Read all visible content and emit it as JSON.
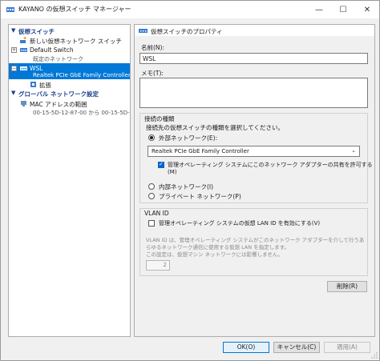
{
  "window": {
    "title": "KAYANO の仮想スイッチ マネージャー",
    "controls": {
      "minimize": "—",
      "maximize": "☐",
      "close": "✕"
    }
  },
  "left_pane": {
    "virtual_switches_header": "仮想スイッチ",
    "items": [
      {
        "label": "新しい仮想ネットワーク スイッチ"
      },
      {
        "label": "Default Switch",
        "sub": "既定のネットワーク",
        "expander": "+"
      },
      {
        "label": "WSL",
        "sub": "Realtek PCIe GbE Family Controller",
        "expander": "−",
        "selected": true
      },
      {
        "label": "拡張"
      }
    ],
    "global_header": "グローバル ネットワーク設定",
    "global_items": [
      {
        "label": "MAC アドレスの範囲",
        "sub": "00-15-5D-12-87-00 から 00-15-5D-..."
      }
    ]
  },
  "right_pane": {
    "header": "仮想スイッチのプロパティ",
    "name_label": "名前(N):",
    "name_value": "WSL",
    "memo_label": "メモ(T):",
    "memo_value": "",
    "connection": {
      "title": "接続の種類",
      "prompt": "接続先の仮想スイッチの種類を選択してください。",
      "external_label": "外部ネットワーク(E):",
      "external_selected": true,
      "adapter_value": "Realtek PCIe GbE Family Controller",
      "share_label_1": "管理オペレーティング システムにこのネットワーク アダプターの共有を許可する",
      "share_label_2": "(M)",
      "share_checked": true,
      "internal_label": "内部ネットワーク(I)",
      "private_label": "プライベート ネットワーク(P)"
    },
    "vlan": {
      "title": "VLAN ID",
      "enable_label": "管理オペレーティング システムの仮想 LAN ID を有効にする(V)",
      "enable_checked": false,
      "desc_1": "VLAN ID は、管理オペレーティング システムがこのネットワーク アダプターを介して行うあ",
      "desc_2": "らゆるネットワーク通信に使用する仮想 LAN を指定します。",
      "desc_3": "この設定は、仮想マシン ネットワークには影響しません。",
      "value": "2"
    },
    "remove_button": "削除(R)"
  },
  "footer": {
    "ok": "OK(O)",
    "cancel": "キャンセル(C)",
    "apply": "適用(A)"
  },
  "colors": {
    "accent": "#0078d7",
    "header_text": "#1a3e8c",
    "pane_bg": "#f0f0f0"
  },
  "icons": [
    "switch-icon",
    "network-icon",
    "mac-address-icon",
    "extension-icon"
  ]
}
